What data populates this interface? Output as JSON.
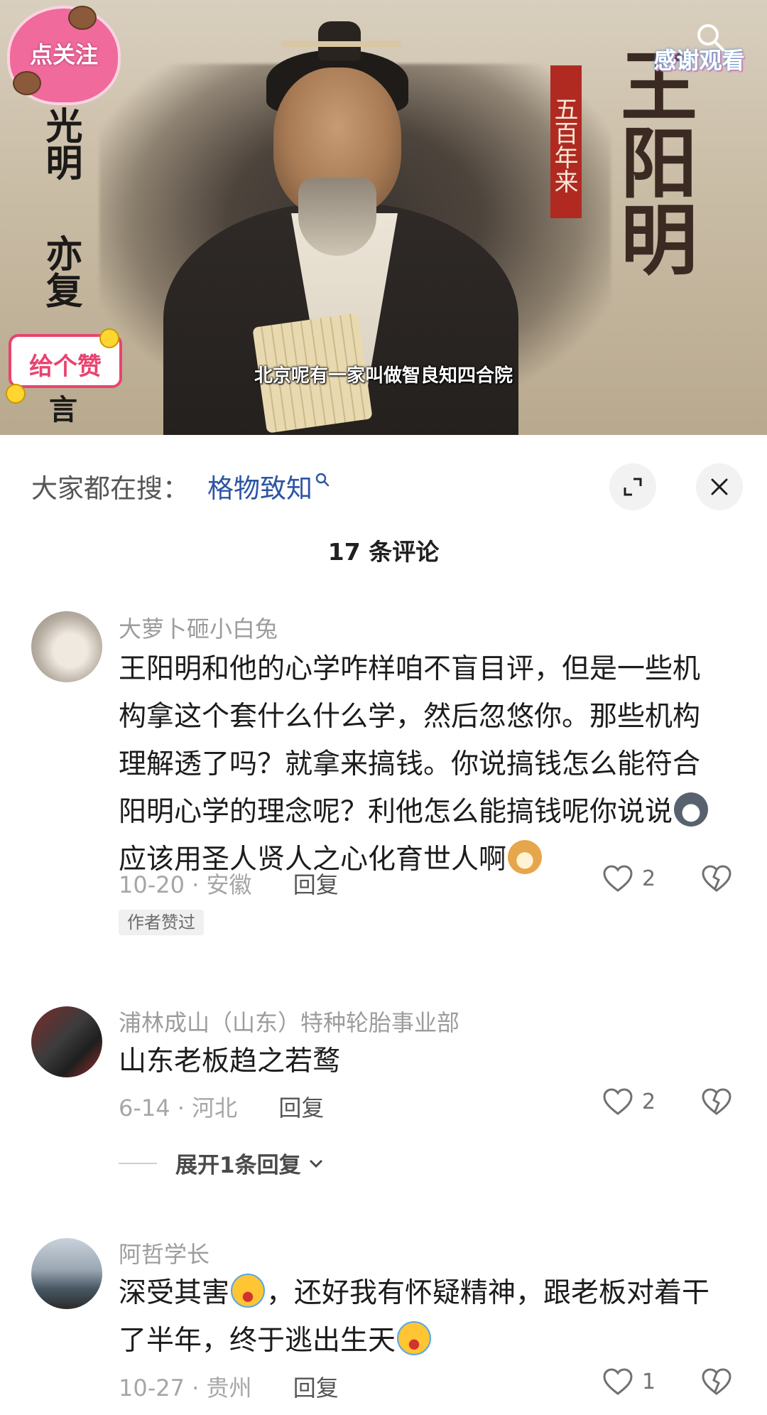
{
  "video": {
    "left_vertical_text_1": "光明",
    "left_vertical_text_2": "亦复",
    "left_vertical_text_3": "言",
    "title_vertical": "王阳明",
    "banner_text": "五百年来",
    "subtitle": "北京呢有一家叫做智良知四合院",
    "sticker_follow": "点关注",
    "sticker_like": "给个赞",
    "sticker_thanks": "感谢观看"
  },
  "search": {
    "label": "大家都在搜：",
    "term": "格物致知",
    "term_icon": "search-icon"
  },
  "comment_count_title": "17 条评论",
  "comments": [
    {
      "name": "大萝卜砸小白兔",
      "text_before_emoji1": "王阳明和他的心学咋样咱不盲目评，但是一些机构拿这个套什么什么学，然后忽悠你。那些机构理解透了吗？就拿来搞钱。你说搞钱怎么能符合阳明心学的理念呢？利他怎么能搞钱呢你说说",
      "text_after_emoji1": "应该用圣人贤人之心化育世人啊",
      "date_location": "10-20 · 安徽",
      "reply_label": "回复",
      "likes": "2",
      "author_tag": "作者赞过"
    },
    {
      "name": "浦林成山（山东）特种轮胎事业部",
      "text": "山东老板趋之若鹜",
      "date_location": "6-14 · 河北",
      "reply_label": "回复",
      "likes": "2",
      "expand_label": "展开1条回复"
    },
    {
      "name": "阿哲学长",
      "text_part1": "深受其害",
      "text_part2": "，还好我有怀疑精神，跟老板对着干了半年，终于逃出生天",
      "date_location": "10-27 · 贵州",
      "reply_label": "回复",
      "likes": "1"
    }
  ],
  "colors": {
    "search_term": "#2d54a3",
    "meta_text": "#a6a6a6",
    "name_text": "#9c9c9c"
  }
}
